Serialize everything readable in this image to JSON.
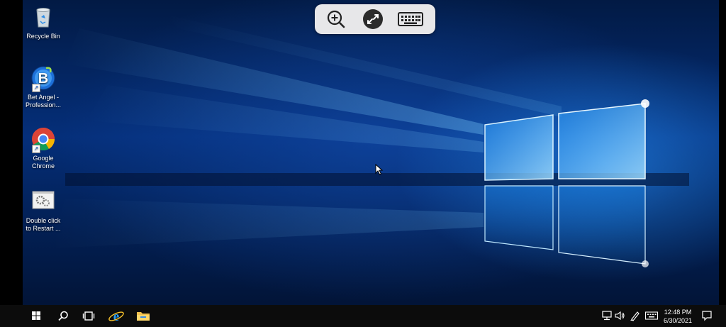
{
  "desktop": {
    "icons": [
      {
        "id": "recycle-bin",
        "label": "Recycle Bin",
        "icon": "recycle-bin-icon"
      },
      {
        "id": "bet-angel",
        "label_line1": "Bet Angel -",
        "label_line2": "Profession...",
        "icon": "bet-angel-icon"
      },
      {
        "id": "google-chrome",
        "label_line1": "Google",
        "label_line2": "Chrome",
        "icon": "chrome-icon"
      },
      {
        "id": "restart",
        "label_line1": "Double click",
        "label_line2": "to Restart ...",
        "icon": "restart-gears-icon"
      }
    ]
  },
  "remote_toolbar": {
    "buttons": [
      "zoom-in-icon",
      "remote-desktop-icon",
      "keyboard-icon"
    ]
  },
  "taskbar": {
    "items": [
      "windows-start-icon",
      "search-icon",
      "task-view-icon",
      "internet-explorer-icon",
      "file-explorer-icon"
    ],
    "tray_icons": [
      "network-icon",
      "volume-icon",
      "pen-icon",
      "touch-keyboard-icon"
    ],
    "clock": {
      "time": "12:48 PM",
      "date": "6/30/2021"
    },
    "notifications_icon": "action-center-icon"
  },
  "colors": {
    "wallpaper_glow": "#4fb6ff",
    "taskbar": "#0c0c0c",
    "toolbar": "#e7e7e9"
  }
}
